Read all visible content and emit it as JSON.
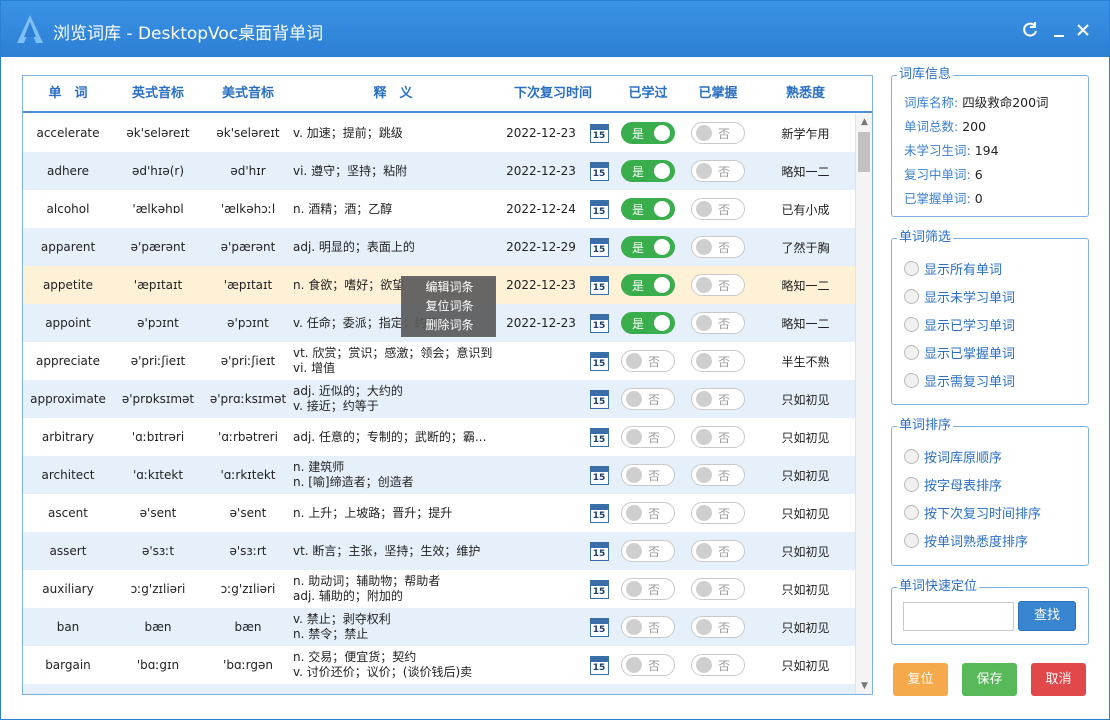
{
  "window": {
    "title": "浏览词库 - DesktopVoc桌面背单词",
    "refresh_icon": "refresh-icon",
    "minimize_icon": "minimize-icon",
    "close_icon": "close-icon",
    "accent": "#2d7fd4"
  },
  "grid": {
    "columns": [
      "单　词",
      "英式音标",
      "美式音标",
      "释　义",
      "下次复习时间",
      "已学过",
      "已掌握",
      "熟悉度"
    ],
    "toggle_on_label": "是",
    "toggle_off_label": "否",
    "calendar_icon": "calendar-icon",
    "calendar_day": "15",
    "rows": [
      {
        "word": "accelerate",
        "uk": "ək'seləreɪt",
        "us": "ək'seləreɪt",
        "meaning": [
          "v. 加速；提前；跳级"
        ],
        "date": "2022-12-23",
        "learned": true,
        "mastered": false,
        "familiarity": "新学乍用",
        "style": "white"
      },
      {
        "word": "adhere",
        "uk": "əd'hɪə(r)",
        "us": "əd'hɪr",
        "meaning": [
          "vi. 遵守；坚持；粘附"
        ],
        "date": "2022-12-23",
        "learned": true,
        "mastered": false,
        "familiarity": "略知一二",
        "style": "alt"
      },
      {
        "word": "alcohol",
        "uk": "'ælkəhɒl",
        "us": "'ælkəhɔːl",
        "meaning": [
          "n. 酒精；酒；乙醇"
        ],
        "date": "2022-12-24",
        "learned": true,
        "mastered": false,
        "familiarity": "已有小成",
        "style": "white"
      },
      {
        "word": "apparent",
        "uk": "ə'pærənt",
        "us": "ə'pærənt",
        "meaning": [
          "adj. 明显的；表面上的"
        ],
        "date": "2022-12-29",
        "learned": true,
        "mastered": false,
        "familiarity": "了然于胸",
        "style": "alt"
      },
      {
        "word": "appetite",
        "uk": "'æpɪtaɪt",
        "us": "'æpɪtaɪt",
        "meaning": [
          "n. 食欲；嗜好；欲望"
        ],
        "date": "2022-12-23",
        "learned": true,
        "mastered": false,
        "familiarity": "略知一二",
        "style": "sel"
      },
      {
        "word": "appoint",
        "uk": "ə'pɔɪnt",
        "us": "ə'pɔɪnt",
        "meaning": [
          "v. 任命；委派；指定；约定"
        ],
        "date": "2022-12-23",
        "learned": true,
        "mastered": false,
        "familiarity": "略知一二",
        "style": "alt"
      },
      {
        "word": "appreciate",
        "uk": "ə'priːʃieɪt",
        "us": "ə'priːʃieɪt",
        "meaning": [
          "vt. 欣赏；赏识；感激；领会；意识到",
          "vi. 增值"
        ],
        "date": "",
        "learned": false,
        "mastered": false,
        "familiarity": "半生不熟",
        "style": "white"
      },
      {
        "word": "approximate",
        "uk": "ə'prɒksɪmət",
        "us": "ə'prɑːksɪmət",
        "meaning": [
          "adj. 近似的；大约的",
          "v. 接近；约等于"
        ],
        "date": "",
        "learned": false,
        "mastered": false,
        "familiarity": "只如初见",
        "style": "alt"
      },
      {
        "word": "arbitrary",
        "uk": "'ɑːbɪtrəri",
        "us": "'ɑːrbətreri",
        "meaning": [
          "adj. 任意的；专制的；武断的；霸..."
        ],
        "date": "",
        "learned": false,
        "mastered": false,
        "familiarity": "只如初见",
        "style": "white"
      },
      {
        "word": "architect",
        "uk": "'ɑːkɪtekt",
        "us": "'ɑːrkɪtekt",
        "meaning": [
          "n. 建筑师",
          "n. [喻]缔造者；创造者"
        ],
        "date": "",
        "learned": false,
        "mastered": false,
        "familiarity": "只如初见",
        "style": "alt"
      },
      {
        "word": "ascent",
        "uk": "ə'sent",
        "us": "ə'sent",
        "meaning": [
          "n. 上升；上坡路；晋升；提升"
        ],
        "date": "",
        "learned": false,
        "mastered": false,
        "familiarity": "只如初见",
        "style": "white"
      },
      {
        "word": "assert",
        "uk": "ə'sɜːt",
        "us": "ə'sɜːrt",
        "meaning": [
          "vt. 断言；主张，坚持；生效；维护"
        ],
        "date": "",
        "learned": false,
        "mastered": false,
        "familiarity": "只如初见",
        "style": "alt"
      },
      {
        "word": "auxiliary",
        "uk": "ɔːg'zɪliəri",
        "us": "ɔːg'zɪliəri",
        "meaning": [
          "n. 助动词；辅助物；帮助者",
          "adj. 辅助的；附加的"
        ],
        "date": "",
        "learned": false,
        "mastered": false,
        "familiarity": "只如初见",
        "style": "white"
      },
      {
        "word": "ban",
        "uk": "bæn",
        "us": "bæn",
        "meaning": [
          "v. 禁止；剥夺权利",
          "n. 禁令；禁止"
        ],
        "date": "",
        "learned": false,
        "mastered": false,
        "familiarity": "只如初见",
        "style": "alt"
      },
      {
        "word": "bargain",
        "uk": "'bɑːgɪn",
        "us": "'bɑːrgən",
        "meaning": [
          "n. 交易；便宜货；契约",
          "v. 讨价还价；议价；(谈价钱后)卖"
        ],
        "date": "",
        "learned": false,
        "mastered": false,
        "familiarity": "只如初见",
        "style": "white"
      },
      {
        "word": "",
        "uk": "",
        "us": "",
        "meaning": [
          ""
        ],
        "date": "",
        "learned": false,
        "mastered": false,
        "familiarity": "",
        "style": "alt"
      }
    ]
  },
  "context_menu": {
    "items": [
      "编辑词条",
      "复位词条",
      "删除词条"
    ]
  },
  "library_info": {
    "title": "词库信息",
    "name_label": "词库名称:",
    "name_value": "四级救命200词",
    "total_label": "单词总数:",
    "total_value": "200",
    "unlearned_label": "未学习生词:",
    "unlearned_value": "194",
    "reviewing_label": "复习中单词:",
    "reviewing_value": "6",
    "mastered_label": "已掌握单词:",
    "mastered_value": "0"
  },
  "filter": {
    "title": "单词筛选",
    "options": [
      "显示所有单词",
      "显示未学习单词",
      "显示已学习单词",
      "显示已掌握单词",
      "显示需复习单词"
    ]
  },
  "sort": {
    "title": "单词排序",
    "options": [
      "按词库原顺序",
      "按字母表排序",
      "按下次复习时间排序",
      "按单词熟悉度排序"
    ]
  },
  "locate": {
    "title": "单词快速定位",
    "input_value": "",
    "button": "查找"
  },
  "buttons": {
    "reset": "复位",
    "save": "保存",
    "cancel": "取消",
    "reset_color": "#f5a94a",
    "save_color": "#57b95a",
    "cancel_color": "#e0484a"
  }
}
